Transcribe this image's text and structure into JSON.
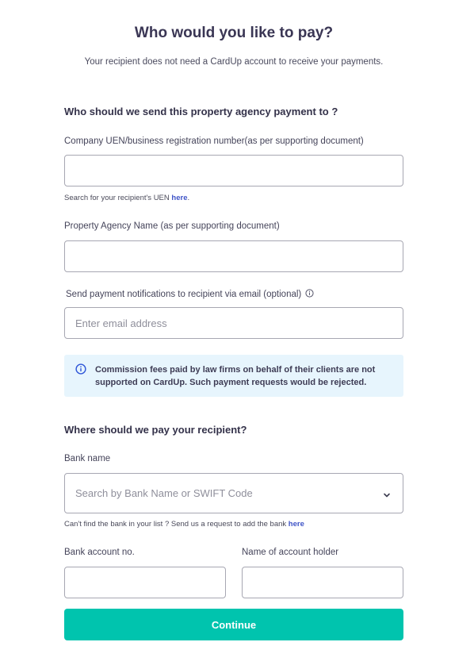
{
  "header": {
    "title": "Who would you like to pay?",
    "subtitle": "Your recipient does not need a CardUp account to receive your payments."
  },
  "recipient_section": {
    "title": "Who should we send this property agency payment to ?",
    "uen": {
      "label": "Company UEN/business registration number(as per supporting document)",
      "value": "",
      "help_prefix": "Search for your recipient's UEN ",
      "help_link": "here",
      "help_suffix": "."
    },
    "agency_name": {
      "label": "Property Agency Name (as per supporting document)",
      "value": ""
    },
    "email": {
      "label": "Send payment notifications to recipient via email (optional)",
      "placeholder": "Enter email address",
      "value": ""
    },
    "notice": {
      "text": "Commission fees paid by law firms on behalf of their clients are not supported on CardUp. Such payment requests would be rejected."
    }
  },
  "bank_section": {
    "title": "Where should we pay your recipient?",
    "bank_name": {
      "label": "Bank name",
      "placeholder": "Search by Bank Name or SWIFT Code",
      "help_prefix": "Can't find the bank in your list ? Send us a request to add the bank ",
      "help_link": "here"
    },
    "account_no": {
      "label": "Bank account no.",
      "value": ""
    },
    "account_holder": {
      "label": "Name of account holder",
      "value": ""
    }
  },
  "actions": {
    "continue_label": "Continue"
  },
  "colors": {
    "accent": "#00c4ae",
    "link": "#3f54c7",
    "notice_background": "#e7f5fd",
    "notice_icon": "#2f56d8"
  },
  "icons": {
    "email_info": "info-circle-icon",
    "notice_info": "info-circle-icon",
    "select_dropdown": "chevron-down-icon"
  }
}
